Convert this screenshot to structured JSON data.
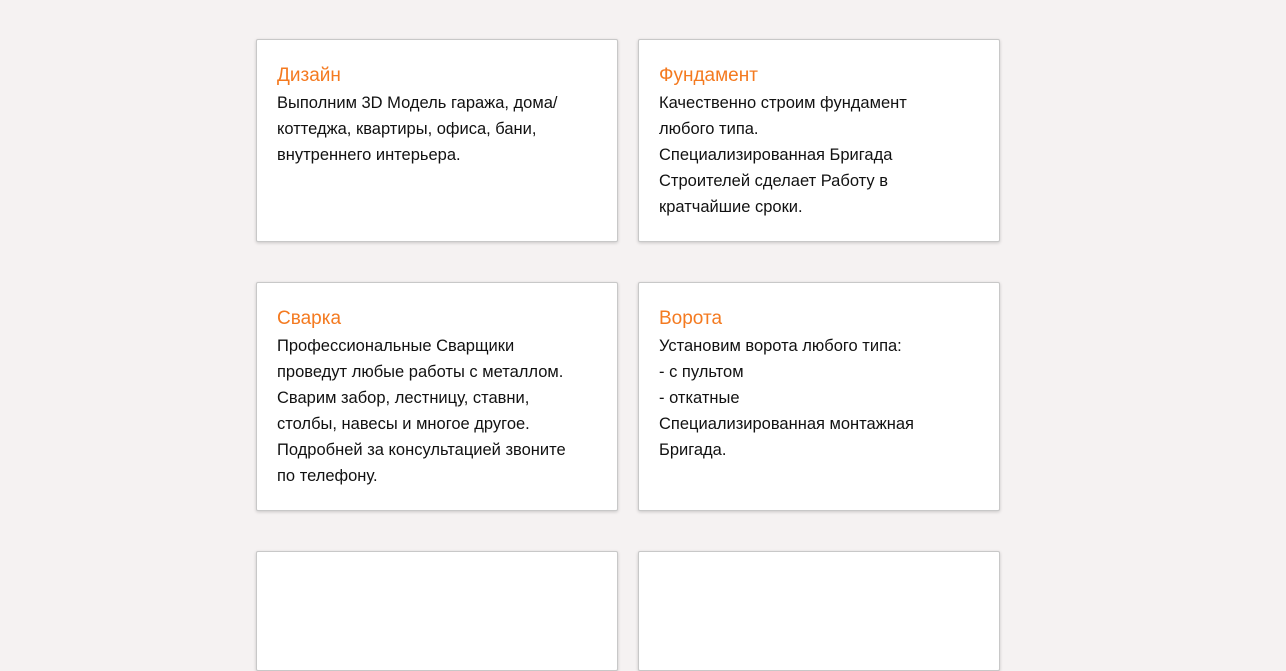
{
  "services": [
    {
      "title": "Дизайн",
      "text": "Выполним 3D Модель гаража, дома/\nкоттеджа, квартиры, офиса, бани,\nвнутреннего интерьера."
    },
    {
      "title": "Фундамент",
      "text": "Качественно строим фундамент\nлюбого типа.\nСпециализированная Бригада\nСтроителей сделает Работу в\nкратчайшие сроки."
    },
    {
      "title": "Сварка",
      "text": "Профессиональные Сварщики\nпроведут любые работы с металлом.\nСварим забор, лестницу, ставни,\nстолбы, навесы и многое другое.\nПодробней за консультацией звоните\nпо телефону."
    },
    {
      "title": "Ворота",
      "text": "Установим ворота любого типа:\n- с пультом\n- откатные\nСпециализированная монтажная\nБригада."
    },
    {
      "title": "",
      "text": ""
    },
    {
      "title": "",
      "text": ""
    }
  ],
  "colors": {
    "page_background": "#f5f2f2",
    "card_background": "#ffffff",
    "title_accent": "#f47a20",
    "body_text": "#111111"
  }
}
